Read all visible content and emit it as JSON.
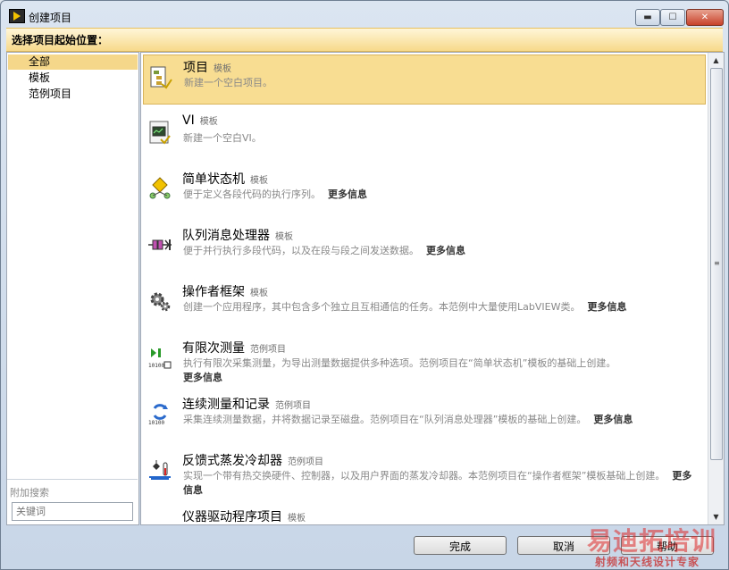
{
  "window": {
    "title": "创建项目",
    "minimize": "▬",
    "maximize": "☐",
    "close": "✕"
  },
  "banner": "选择项目起始位置：",
  "categories": [
    "全部",
    "模板",
    "范例项目"
  ],
  "additional_search": {
    "label": "附加搜索",
    "placeholder": "关键词"
  },
  "items": [
    {
      "name": "项目",
      "tag": "模板",
      "desc": "新建一个空白项目。",
      "more": "",
      "icon": "project-icon"
    },
    {
      "name": "VI",
      "tag": "模板",
      "desc": "新建一个空白VI。",
      "more": "",
      "icon": "vi-icon"
    },
    {
      "name": "简单状态机",
      "tag": "模板",
      "desc": "便于定义各段代码的执行序列。",
      "more": "更多信息",
      "icon": "state-machine-icon"
    },
    {
      "name": "队列消息处理器",
      "tag": "模板",
      "desc": "便于并行执行多段代码，以及在段与段之间发送数据。",
      "more": "更多信息",
      "icon": "queue-icon"
    },
    {
      "name": "操作者框架",
      "tag": "模板",
      "desc": "创建一个应用程序，其中包含多个独立且互相通信的任务。本范例中大量使用LabVIEW类。",
      "more": "更多信息",
      "icon": "gears-icon"
    },
    {
      "name": "有限次测量",
      "tag": "范例项目",
      "desc": "执行有限次采集测量，为导出测量数据提供多种选项。范例项目在“简单状态机”模板的基础上创建。",
      "more": "更多信息",
      "icon": "finite-measure-icon"
    },
    {
      "name": "连续测量和记录",
      "tag": "范例项目",
      "desc": "采集连续测量数据，并将数据记录至磁盘。范例项目在“队列消息处理器”模板的基础上创建。",
      "more": "更多信息",
      "icon": "continuous-measure-icon"
    },
    {
      "name": "反馈式蒸发冷却器",
      "tag": "范例项目",
      "desc": "实现一个带有热交换硬件、控制器，以及用户界面的蒸发冷却器。本范例项目在“操作者框架”模板基础上创建。",
      "more": "更多信息",
      "icon": "cooler-icon"
    },
    {
      "name": "仪器驱动程序项目",
      "tag": "模板",
      "desc": "",
      "more": "",
      "icon": "instrument-icon"
    }
  ],
  "buttons": {
    "ok": "完成",
    "cancel": "取消",
    "help": "帮助"
  },
  "watermark": {
    "main": "易迪拓培训",
    "sub": "射频和天线设计专家"
  },
  "colors": {
    "selection": "#f8dd92",
    "banner": "#f7d98a"
  }
}
